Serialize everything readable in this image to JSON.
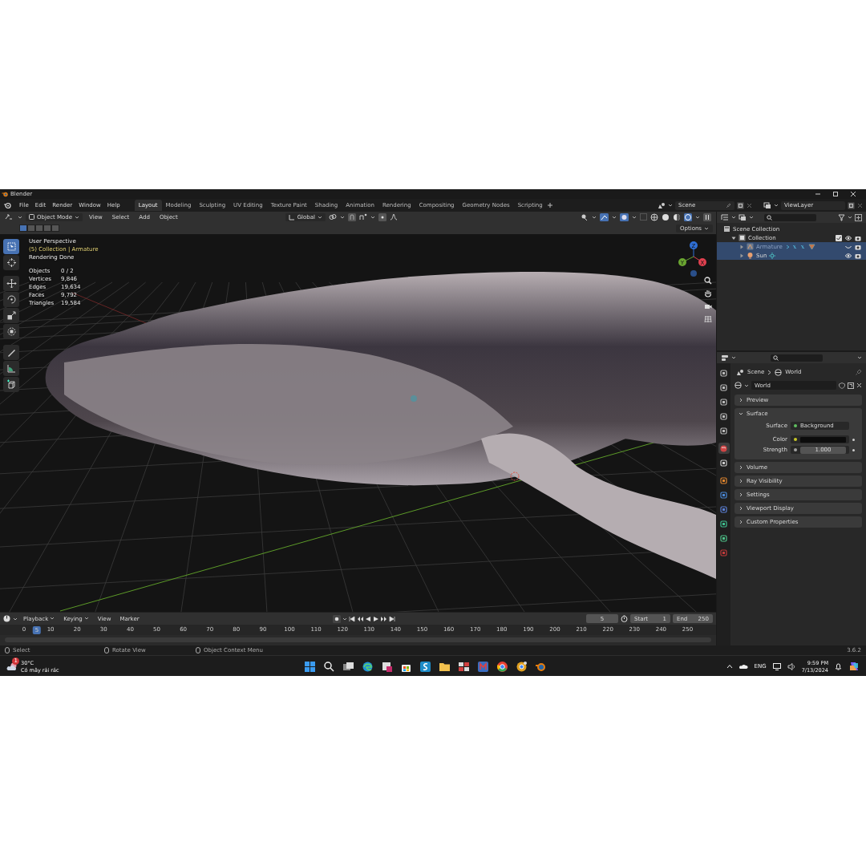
{
  "window": {
    "title": "Blender"
  },
  "menu": [
    "File",
    "Edit",
    "Render",
    "Window",
    "Help"
  ],
  "workspaces": [
    {
      "label": "Layout",
      "selected": true
    },
    {
      "label": "Modeling",
      "selected": false
    },
    {
      "label": "Sculpting",
      "selected": false
    },
    {
      "label": "UV Editing",
      "selected": false
    },
    {
      "label": "Texture Paint",
      "selected": false
    },
    {
      "label": "Shading",
      "selected": false
    },
    {
      "label": "Animation",
      "selected": false
    },
    {
      "label": "Rendering",
      "selected": false
    },
    {
      "label": "Compositing",
      "selected": false
    },
    {
      "label": "Geometry Nodes",
      "selected": false
    },
    {
      "label": "Scripting",
      "selected": false
    }
  ],
  "scene_selector": {
    "value": "Scene"
  },
  "view_layer_selector": {
    "value": "ViewLayer"
  },
  "viewport_header": {
    "mode": "Object Mode",
    "menus": [
      "View",
      "Select",
      "Add",
      "Object"
    ],
    "orientation": "Global",
    "options": "Options"
  },
  "select_modes": [
    {
      "selected": true
    },
    {
      "selected": false
    },
    {
      "selected": false
    },
    {
      "selected": false
    },
    {
      "selected": false
    }
  ],
  "tools": [
    {
      "kind": "select",
      "selected": true
    },
    {
      "kind": "cursor",
      "selected": false
    },
    {
      "kind": "move",
      "selected": false
    },
    {
      "kind": "rotate",
      "selected": false
    },
    {
      "kind": "scale",
      "selected": false
    },
    {
      "kind": "transform",
      "selected": false
    },
    {
      "kind": "annotate",
      "selected": false
    },
    {
      "kind": "measure",
      "selected": false
    },
    {
      "kind": "add_cube",
      "selected": false
    }
  ],
  "viewport_info": {
    "perspective": "User Perspective",
    "context": "(5) Collection | Armature",
    "status": "Rendering Done",
    "stats": [
      {
        "label": "Objects",
        "value": "0 / 2"
      },
      {
        "label": "Vertices",
        "value": "9,846"
      },
      {
        "label": "Edges",
        "value": "19,634"
      },
      {
        "label": "Faces",
        "value": "9,792"
      },
      {
        "label": "Triangles",
        "value": "19,584"
      }
    ]
  },
  "gizmo": {
    "axes": [
      {
        "label": "Z",
        "color": "#2f6fd6"
      },
      {
        "label": "Y",
        "color": "#6aa531"
      },
      {
        "label": "X",
        "color": "#e0404f"
      }
    ]
  },
  "outliner": {
    "tree": [
      {
        "label": "Scene Collection",
        "children": [
          {
            "label": "Collection",
            "expanded": true,
            "children": [
              {
                "label": "Armature",
                "selected": true,
                "visible": false
              },
              {
                "label": "Sun",
                "selected": true,
                "visible": true
              }
            ]
          }
        ]
      }
    ]
  },
  "properties": {
    "tabs": [
      {
        "kind": "tool",
        "selected": false
      },
      {
        "kind": "render",
        "selected": false
      },
      {
        "kind": "output",
        "selected": false
      },
      {
        "kind": "view_layer",
        "selected": false
      },
      {
        "kind": "scene",
        "selected": false
      },
      {
        "kind": "world",
        "selected": true
      },
      {
        "kind": "collection",
        "selected": false
      },
      {
        "kind": "object",
        "selected": false
      },
      {
        "kind": "physics",
        "selected": false
      },
      {
        "kind": "constraints",
        "selected": false
      },
      {
        "kind": "data",
        "selected": false
      },
      {
        "kind": "bone",
        "selected": false
      },
      {
        "kind": "texture",
        "selected": false
      }
    ],
    "breadcrumb": [
      "Scene",
      "World"
    ],
    "datablock": "World",
    "panels": [
      {
        "label": "Preview",
        "expanded": false
      },
      {
        "label": "Surface",
        "expanded": true,
        "fields": [
          {
            "label": "Surface",
            "kind": "shader",
            "value": "Background"
          },
          {
            "label": "Color",
            "kind": "color"
          },
          {
            "label": "Strength",
            "kind": "number",
            "value": "1.000"
          }
        ]
      },
      {
        "label": "Volume",
        "expanded": false
      },
      {
        "label": "Ray Visibility",
        "expanded": false
      },
      {
        "label": "Settings",
        "expanded": false
      },
      {
        "label": "Viewport Display",
        "expanded": false
      },
      {
        "label": "Custom Properties",
        "expanded": false
      }
    ]
  },
  "timeline": {
    "menus": [
      "Playback",
      "Keying",
      "View",
      "Marker"
    ],
    "current_frame": "5",
    "start_label": "Start",
    "start": "1",
    "end_label": "End",
    "end": "250",
    "playhead": "5",
    "ruler": [
      "0",
      "10",
      "20",
      "30",
      "40",
      "50",
      "60",
      "70",
      "80",
      "90",
      "100",
      "110",
      "120",
      "130",
      "140",
      "150",
      "160",
      "170",
      "180",
      "190",
      "200",
      "210",
      "220",
      "230",
      "240",
      "250"
    ]
  },
  "status_bar": {
    "hints": [
      "Select",
      "Rotate View",
      "Object Context Menu"
    ],
    "version": "3.6.2"
  },
  "taskbar": {
    "weather": {
      "badge": "1",
      "temperature": "30°C",
      "description": "Có mây rải rác"
    },
    "language": "ENG",
    "time": "9:59 PM",
    "date": "7/13/2024"
  }
}
